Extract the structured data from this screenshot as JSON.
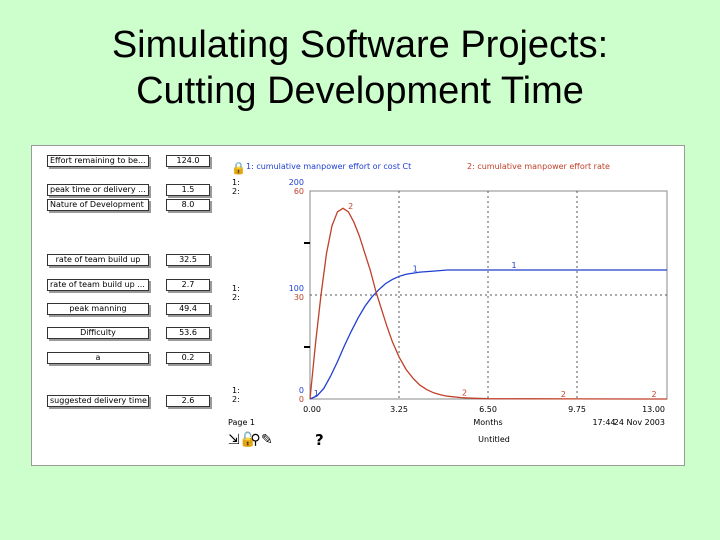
{
  "slide": {
    "title_line1": "Simulating Software Projects:",
    "title_line2": "Cutting Development Time"
  },
  "variables": [
    {
      "label": "Effort remaining to be...",
      "value": "124.0",
      "align": "left"
    },
    {
      "label": "peak time or delivery ...",
      "value": "1.5",
      "align": "left"
    },
    {
      "label": "Nature of Development",
      "value": "8.0",
      "align": "left"
    },
    {
      "label": "rate of team build up",
      "value": "32.5",
      "align": "center"
    },
    {
      "label": "rate of team build up ...",
      "value": "2.7",
      "align": "left"
    },
    {
      "label": "peak manning",
      "value": "49.4",
      "align": "center"
    },
    {
      "label": "Difficulty",
      "value": "53.6",
      "align": "center"
    },
    {
      "label": "a",
      "value": "0.2",
      "align": "center"
    },
    {
      "label": "suggested delivery time",
      "value": "2.6",
      "align": "left"
    }
  ],
  "graph": {
    "legend1": "1: cumulative manpower effort or cost Ct",
    "legend2": "2: cumulative manpower effort rate",
    "axis_ids": {
      "top1": "1:",
      "top2": "2:",
      "mid1": "1:",
      "mid2": "2:",
      "bot1": "1:",
      "bot2": "2:"
    },
    "y1_ticks": [
      "200",
      "100",
      "0"
    ],
    "y2_ticks": [
      "60",
      "30",
      "0"
    ],
    "x_ticks": [
      "0.00",
      "3.25",
      "6.50",
      "9.75",
      "13.00"
    ],
    "xlabel": "Months",
    "page_label": "Page 1",
    "timestamp": "17:44",
    "date": "24 Nov 2003",
    "doc_name": "Untitled",
    "colors": {
      "series1": "#1f3fd0",
      "series2": "#c0402a",
      "labels1": "#1f3fd0",
      "labels2": "#c0402a"
    }
  },
  "chart_data": {
    "type": "line",
    "title": "",
    "xlabel": "Months",
    "xlim": [
      0,
      13
    ],
    "series": [
      {
        "name": "1: cumulative manpower effort or cost Ct",
        "axis": "left",
        "ylim": [
          0,
          200
        ],
        "x": [
          0,
          0.25,
          0.5,
          0.75,
          1.0,
          1.25,
          1.5,
          1.75,
          2.0,
          2.25,
          2.5,
          2.75,
          3.0,
          3.25,
          3.5,
          4.0,
          4.5,
          5.0,
          5.5,
          6.0,
          6.5,
          8.0,
          9.75,
          11.0,
          13.0
        ],
        "y": [
          0,
          3,
          10,
          22,
          36,
          51,
          65,
          78,
          89,
          98,
          105,
          111,
          115,
          118,
          120,
          122,
          123,
          124,
          124,
          124,
          124,
          124,
          124,
          124,
          124
        ],
        "markers": [
          {
            "x": 0.1,
            "label": "1"
          },
          {
            "x": 3.7,
            "label": "1"
          },
          {
            "x": 7.3,
            "label": "1"
          }
        ]
      },
      {
        "name": "2: cumulative manpower effort rate",
        "axis": "right",
        "ylim": [
          0,
          60
        ],
        "x": [
          0,
          0.2,
          0.4,
          0.6,
          0.8,
          1.0,
          1.2,
          1.4,
          1.6,
          1.8,
          2.0,
          2.2,
          2.4,
          2.6,
          2.8,
          3.0,
          3.25,
          3.5,
          3.75,
          4.0,
          4.25,
          4.5,
          4.75,
          5.0,
          5.5,
          6.0,
          6.5,
          8.0,
          9.75,
          13.0
        ],
        "y": [
          0,
          16,
          30,
          42,
          50,
          54,
          55,
          54,
          51,
          47,
          42,
          37,
          31,
          26,
          21,
          16.5,
          12,
          8.5,
          6,
          4,
          2.7,
          1.8,
          1.2,
          0.8,
          0.4,
          0.2,
          0.1,
          0.05,
          0.02,
          0
        ],
        "markers": [
          {
            "x": 1.35,
            "label": "2"
          },
          {
            "x": 5.5,
            "label": "2"
          },
          {
            "x": 9.1,
            "label": "2"
          },
          {
            "x": 12.4,
            "label": "2"
          }
        ]
      }
    ]
  }
}
